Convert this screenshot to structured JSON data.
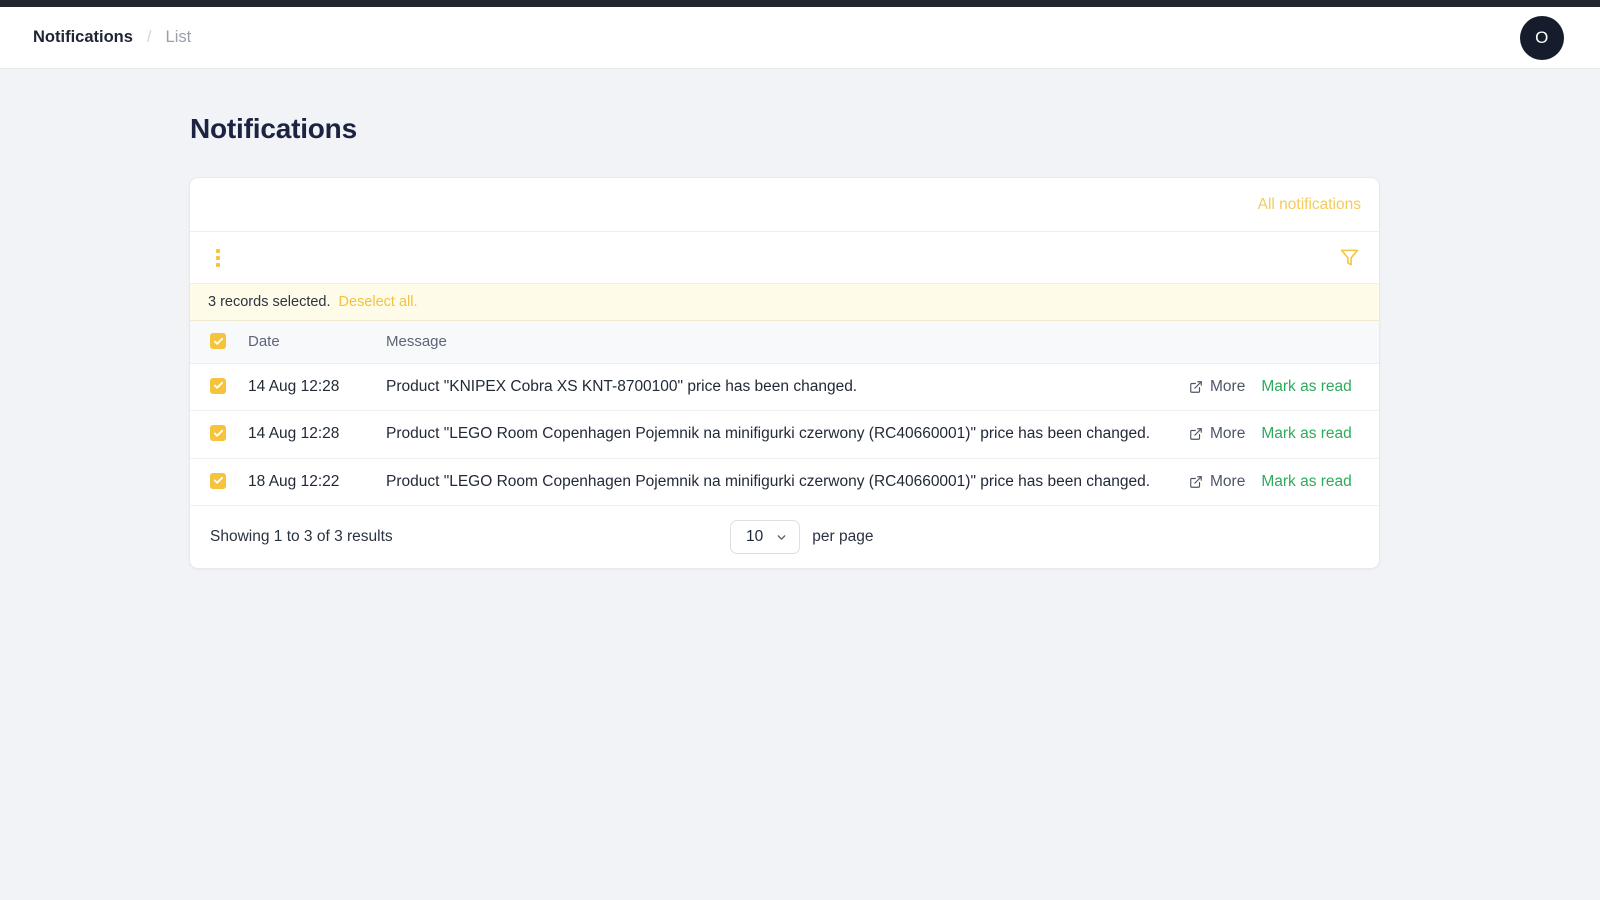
{
  "topbar": {
    "breadcrumb": {
      "root": "Notifications",
      "separator": "/",
      "current": "List"
    },
    "avatar_initial": "O"
  },
  "page": {
    "title": "Notifications"
  },
  "card": {
    "header_link": "All notifications",
    "toolbar": {
      "menu_icon": "kebab-menu-icon",
      "filter_icon": "funnel-filter-icon"
    },
    "selection_banner": {
      "text": "3 records selected.",
      "action": "Deselect all."
    },
    "table": {
      "columns": [
        "Date",
        "Message"
      ],
      "rows": [
        {
          "date": "14 Aug 12:28",
          "message": "Product \"KNIPEX Cobra XS KNT-8700100\" price has been changed.",
          "more": "More",
          "mark_read": "Mark as read"
        },
        {
          "date": "14 Aug 12:28",
          "message": "Product \"LEGO Room Copenhagen Pojemnik na minifigurki czerwony (RC40660001)\" price has been changed.",
          "more": "More",
          "mark_read": "Mark as read"
        },
        {
          "date": "18 Aug 12:22",
          "message": "Product \"LEGO Room Copenhagen Pojemnik na minifigurki czerwony (RC40660001)\" price has been changed.",
          "more": "More",
          "mark_read": "Mark as read"
        }
      ]
    },
    "footer": {
      "showing": "Showing 1 to 3 of 3 results",
      "per_page_value": "10",
      "per_page_label": "per page"
    }
  },
  "colors": {
    "accent_amber": "#f5c33c",
    "link_green": "#2faa5b",
    "banner_bg": "#fefbe9",
    "title": "#1b2340"
  }
}
